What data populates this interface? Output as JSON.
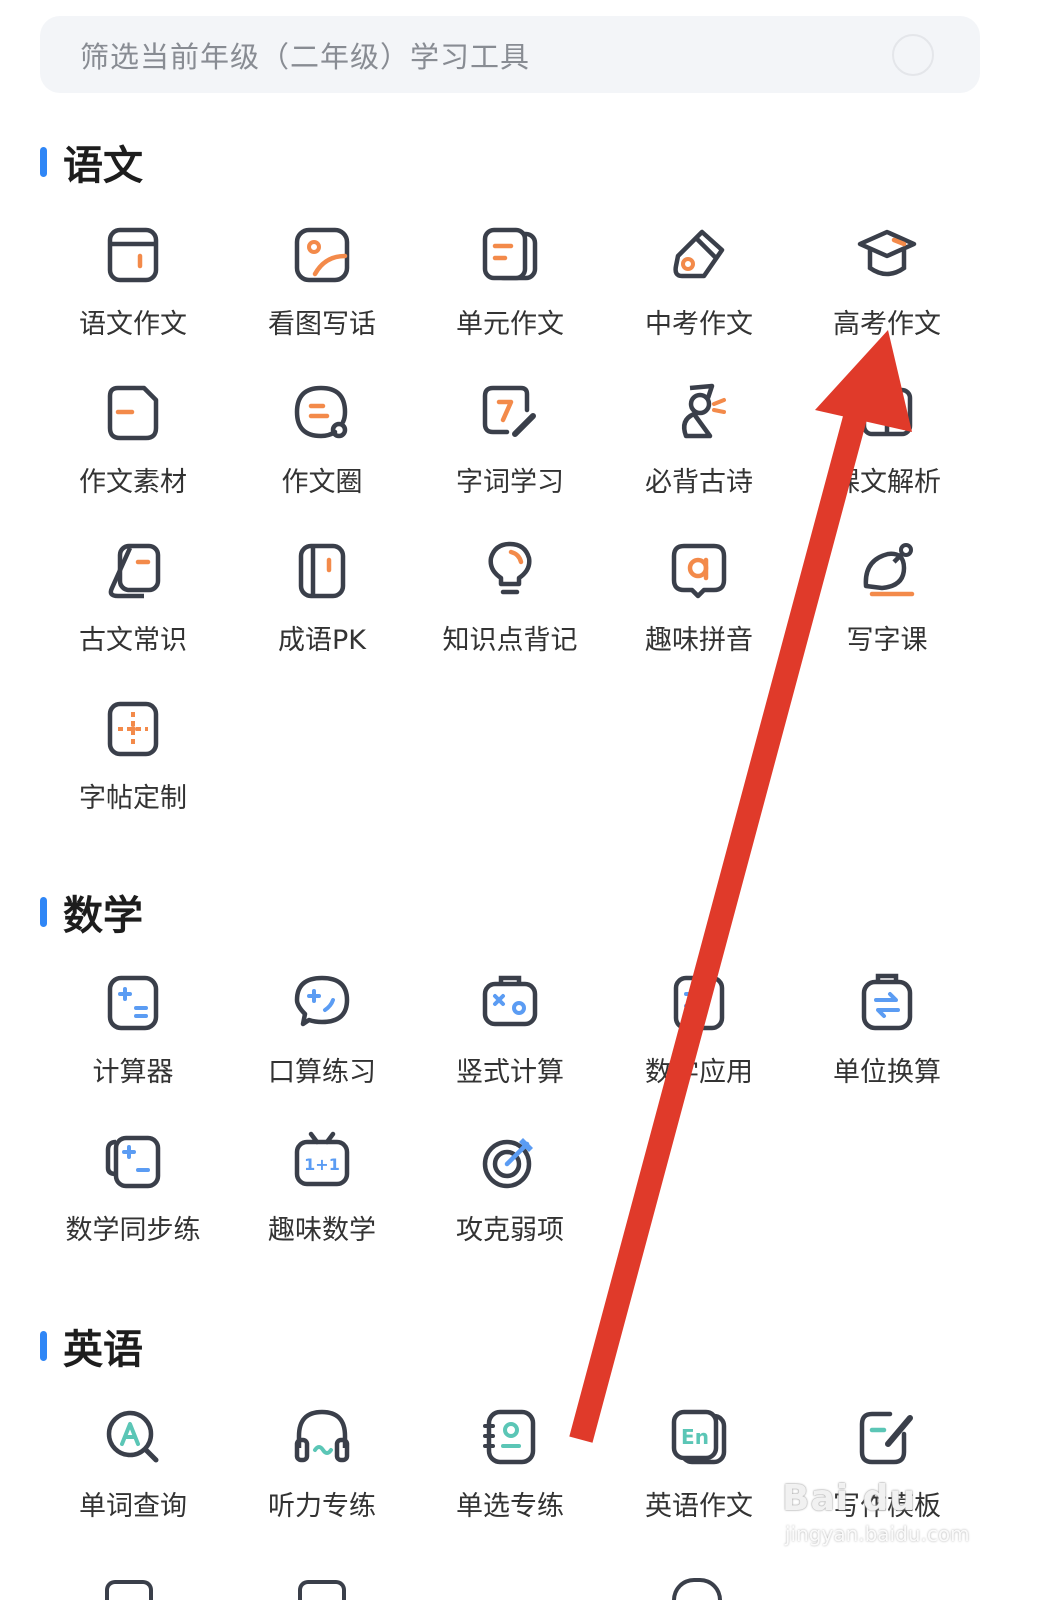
{
  "filter": {
    "text": "筛选当前年级（二年级）学习工具"
  },
  "sections": {
    "chinese": {
      "title": "语文",
      "items": [
        "语文作文",
        "看图写话",
        "单元作文",
        "中考作文",
        "高考作文",
        "作文素材",
        "作文圈",
        "字词学习",
        "必背古诗",
        "课文解析",
        "古文常识",
        "成语PK",
        "知识点背记",
        "趣味拼音",
        "写字课",
        "字帖定制"
      ]
    },
    "math": {
      "title": "数学",
      "items": [
        "计算器",
        "口算练习",
        "竖式计算",
        "数学应用",
        "单位换算",
        "数学同步练",
        "趣味数学",
        "攻克弱项"
      ]
    },
    "english": {
      "title": "英语",
      "items": [
        "单词查询",
        "听力专练",
        "单选专练",
        "英语作文",
        "写作模板"
      ]
    }
  },
  "watermark": {
    "logo": "Bai du",
    "url": "jingyan.baidu.com"
  },
  "colors": {
    "accent": "#2f86f6",
    "icon_stroke": "#3a3f4a",
    "icon_orange": "#f38a4a",
    "icon_blue": "#5b9cf3",
    "arrow": "#e03a2a"
  }
}
